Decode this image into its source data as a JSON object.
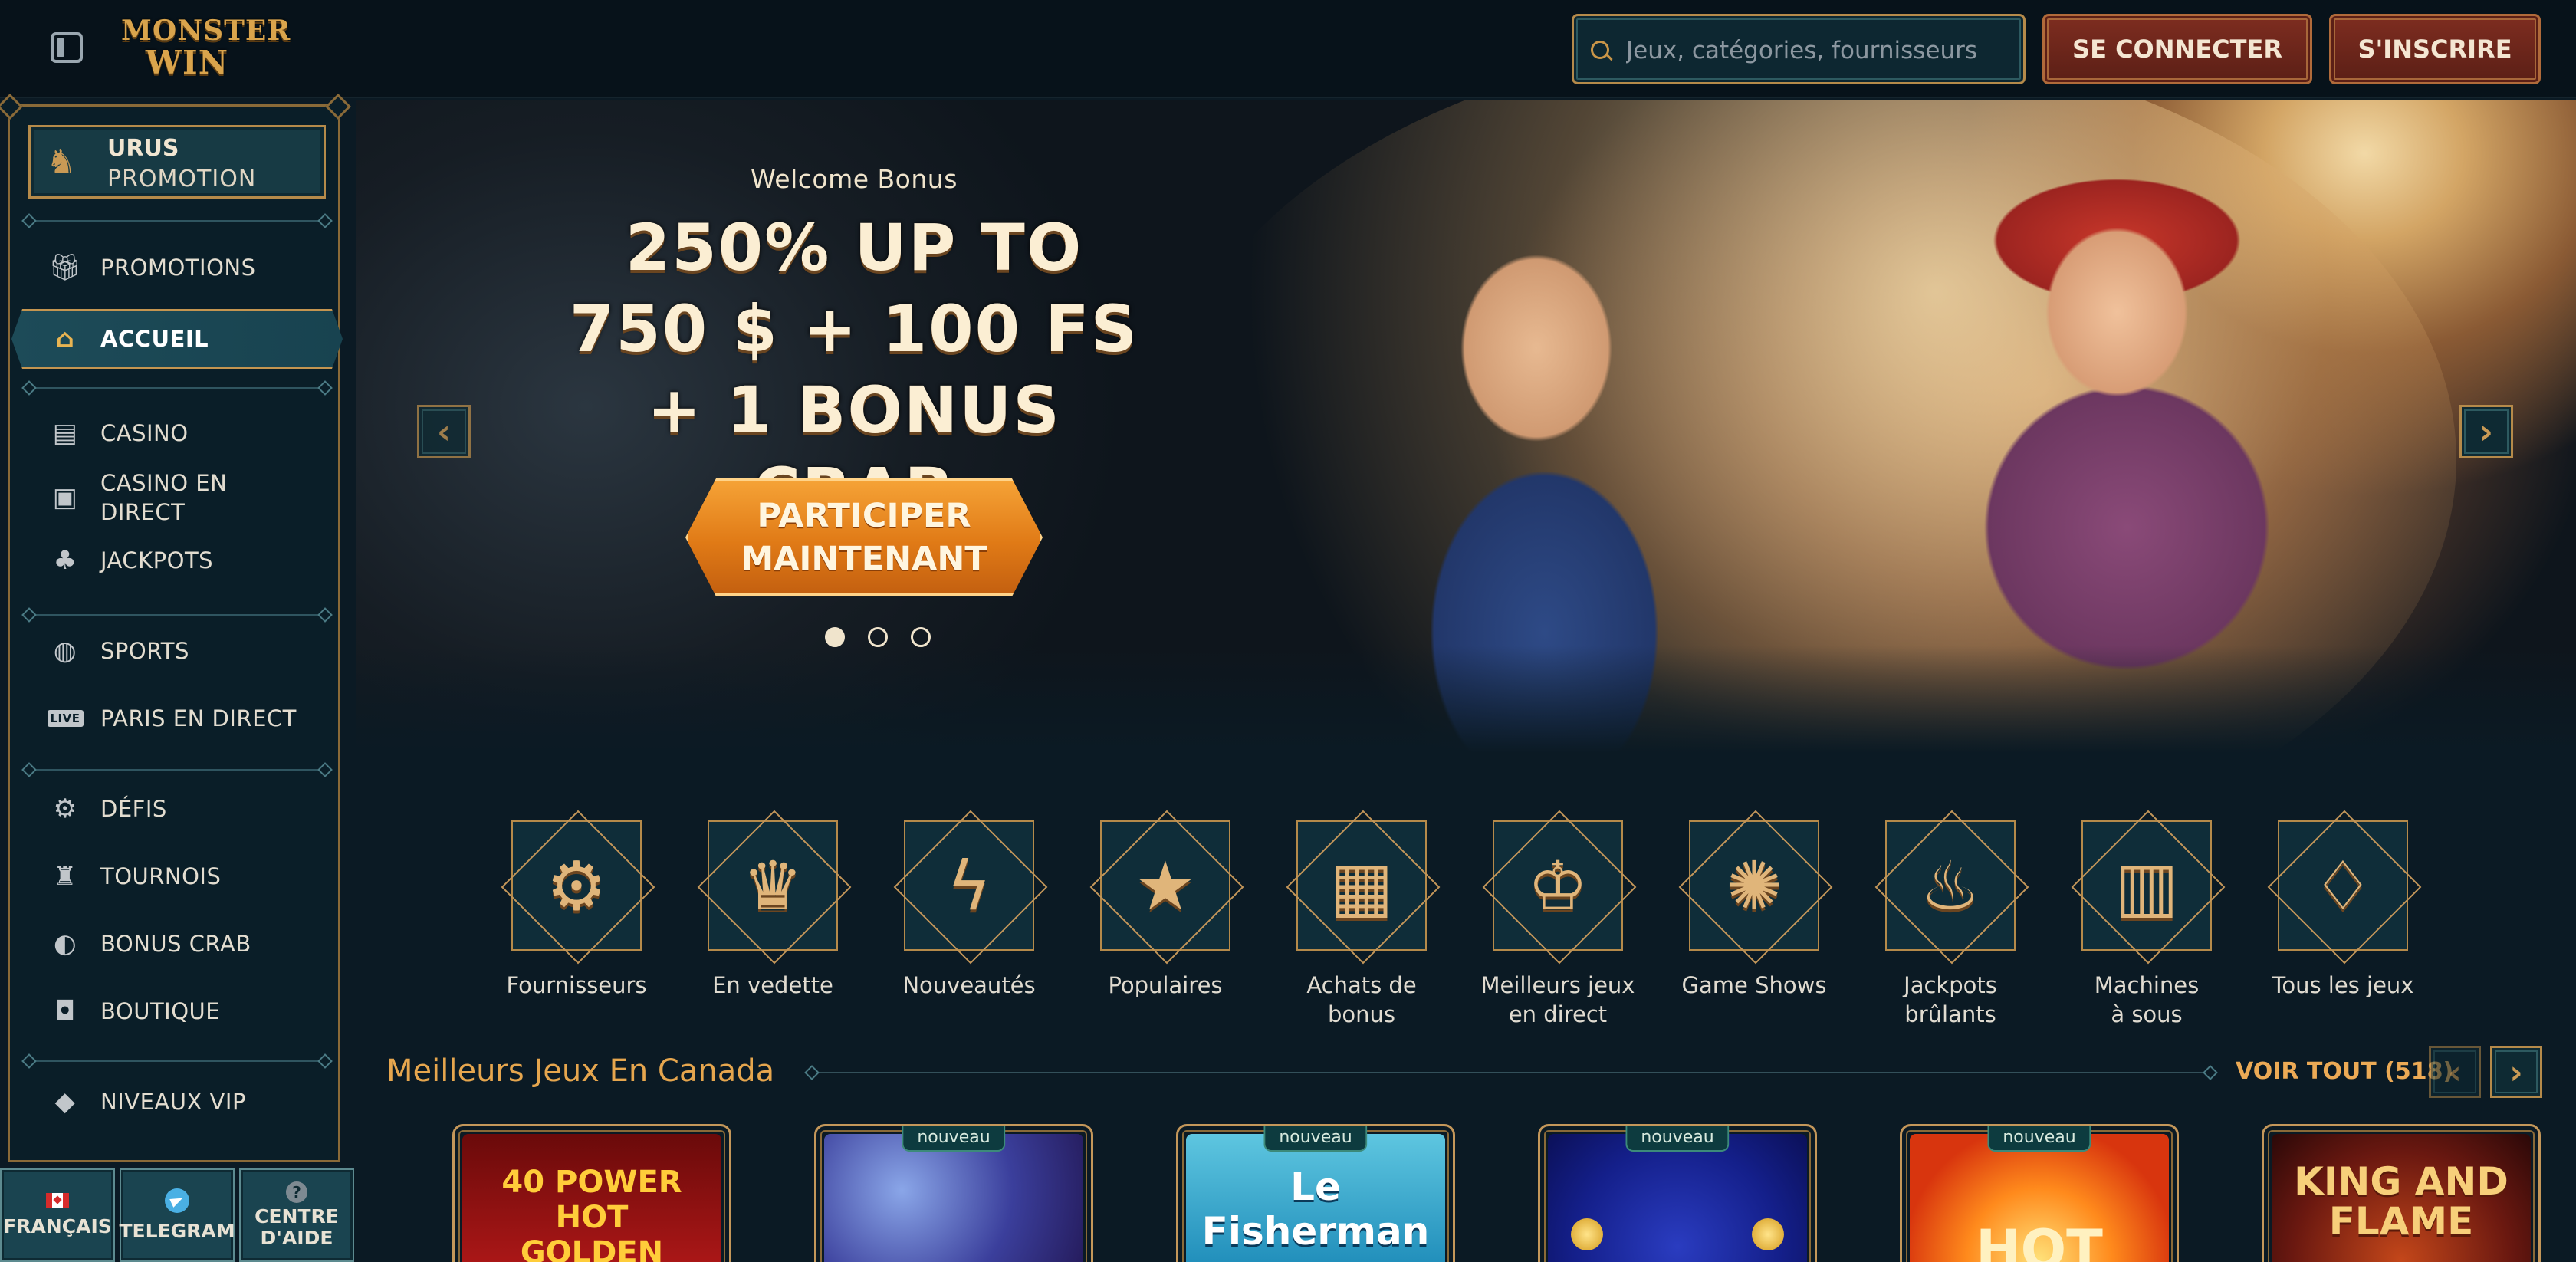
{
  "header": {
    "logo_line1": "MONSTER",
    "logo_line2": "WIN",
    "search_placeholder": "Jeux, catégories, fournisseurs",
    "login_label": "SE CONNECTER",
    "signup_label": "S'INSCRIRE"
  },
  "sidebar": {
    "promo_card": {
      "title": "URUS",
      "subtitle": "PROMOTION"
    },
    "items": [
      {
        "label": "PROMOTIONS",
        "icon": "gift-icon"
      },
      {
        "label": "ACCUEIL",
        "icon": "home-icon",
        "active": true
      },
      {
        "label": "CASINO",
        "icon": "slot-machine-icon"
      },
      {
        "label": "CASINO EN DIRECT",
        "icon": "live-card-icon"
      },
      {
        "label": "JACKPOTS",
        "icon": "clover-icon"
      },
      {
        "label": "SPORTS",
        "icon": "ball-icon"
      },
      {
        "label": "PARIS EN DIRECT",
        "icon": "live-badge-icon"
      },
      {
        "label": "DÉFIS",
        "icon": "gear-badge-icon"
      },
      {
        "label": "TOURNOIS",
        "icon": "trophy-icon"
      },
      {
        "label": "BONUS CRAB",
        "icon": "crab-icon"
      },
      {
        "label": "BOUTIQUE",
        "icon": "shopping-bag-icon"
      },
      {
        "label": "NIVEAUX VIP",
        "icon": "diamond-icon"
      }
    ],
    "live_badge": "LIVE",
    "bottom": {
      "language": "FRANÇAIS",
      "telegram": "TELEGRAM",
      "help_line1": "CENTRE",
      "help_line2": "D'AIDE",
      "help_glyph": "?"
    }
  },
  "hero": {
    "subtitle": "Welcome Bonus",
    "title": "250% UP TO 750 $ + 100 FS + 1 BONUS CRAB",
    "cta_line1": "PARTICIPER",
    "cta_line2": "MAINTENANT",
    "slides_total": 3,
    "slide_active": 1,
    "prev_arrow": "‹",
    "next_arrow": "›"
  },
  "categories": [
    {
      "label": "Fournisseurs",
      "icon": "book-gear-icon"
    },
    {
      "label": "En vedette",
      "icon": "crown-icon"
    },
    {
      "label": "Nouveautés",
      "icon": "lightning-icon"
    },
    {
      "label": "Populaires",
      "icon": "star-icon"
    },
    {
      "label": "Achats de bonus",
      "icon": "gift-box-icon"
    },
    {
      "label": "Meilleurs jeux en direct",
      "icon": "poker-chip-icon"
    },
    {
      "label": "Game Shows",
      "icon": "wheel-icon"
    },
    {
      "label": "Jackpots brûlants",
      "icon": "flame-icon"
    },
    {
      "label": "Machines à sous",
      "icon": "slot-777-icon"
    },
    {
      "label": "Tous les jeux",
      "icon": "cherries-icon"
    }
  ],
  "games_section": {
    "title": "Meilleurs Jeux En Canada",
    "view_all": "VOIR TOUT (518)",
    "prev_arrow": "‹",
    "next_arrow": "›",
    "badge": "nouveau",
    "games": [
      {
        "title_line1": "40 POWER HOT",
        "title_line2": "GOLDEN COINS",
        "is_new": false
      },
      {
        "title_line1": "",
        "title_line2": "",
        "is_new": true
      },
      {
        "title_line1": "Le Fisherman",
        "title_line2": "",
        "is_new": true
      },
      {
        "title_line1": "",
        "title_line2": "",
        "is_new": true
      },
      {
        "title_line1": "HOT",
        "title_line2": "",
        "is_new": true
      },
      {
        "title_line1": "KING AND",
        "title_line2": "FLAME",
        "is_new": false
      }
    ]
  },
  "colors": {
    "background": "#0b1a24",
    "accent_gold": "#c4975a",
    "accent_orange": "#e6a64e",
    "button_red": "#7e2d20",
    "cta_orange": "#e07a16"
  }
}
